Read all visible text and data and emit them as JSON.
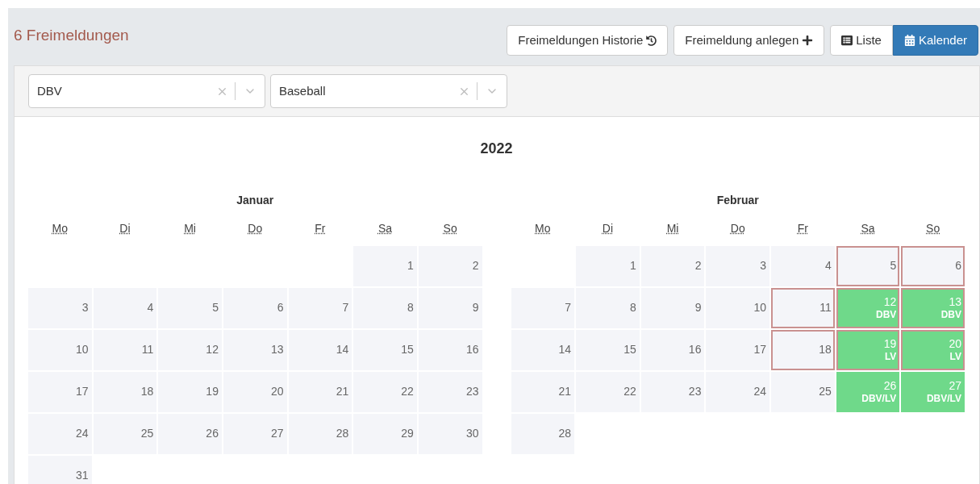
{
  "title": "6 Freimeldungen",
  "buttons": [
    {
      "label": "Freimeldungen Historie",
      "kind": "history"
    },
    {
      "label": "Freimeldung anlegen",
      "kind": "add"
    }
  ],
  "view_toggle": [
    {
      "label": "Liste",
      "kind": "list",
      "selected": false
    },
    {
      "label": "Kalender",
      "kind": "calendar",
      "selected": true
    }
  ],
  "filters": [
    {
      "value": "DBV"
    },
    {
      "value": "Baseball"
    }
  ],
  "year": "2022",
  "months": [
    {
      "name": "Januar",
      "weekdays": [
        "Mo",
        "Di",
        "Mi",
        "Do",
        "Fr",
        "Sa",
        "So"
      ],
      "weeks": [
        [
          {
            "kind": "empty"
          },
          {
            "kind": "empty"
          },
          {
            "kind": "empty"
          },
          {
            "kind": "empty"
          },
          {
            "kind": "empty"
          },
          {
            "kind": "day",
            "day": "1",
            "marked": false,
            "free": false
          },
          {
            "kind": "day",
            "day": "2",
            "marked": false,
            "free": false
          }
        ],
        [
          {
            "kind": "day",
            "day": "3",
            "marked": false,
            "free": false
          },
          {
            "kind": "day",
            "day": "4",
            "marked": false,
            "free": false
          },
          {
            "kind": "day",
            "day": "5",
            "marked": false,
            "free": false
          },
          {
            "kind": "day",
            "day": "6",
            "marked": false,
            "free": false
          },
          {
            "kind": "day",
            "day": "7",
            "marked": false,
            "free": false
          },
          {
            "kind": "day",
            "day": "8",
            "marked": false,
            "free": false
          },
          {
            "kind": "day",
            "day": "9",
            "marked": false,
            "free": false
          }
        ],
        [
          {
            "kind": "day",
            "day": "10",
            "marked": false,
            "free": false
          },
          {
            "kind": "day",
            "day": "11",
            "marked": false,
            "free": false
          },
          {
            "kind": "day",
            "day": "12",
            "marked": false,
            "free": false
          },
          {
            "kind": "day",
            "day": "13",
            "marked": false,
            "free": false
          },
          {
            "kind": "day",
            "day": "14",
            "marked": false,
            "free": false
          },
          {
            "kind": "day",
            "day": "15",
            "marked": false,
            "free": false
          },
          {
            "kind": "day",
            "day": "16",
            "marked": false,
            "free": false
          }
        ],
        [
          {
            "kind": "day",
            "day": "17",
            "marked": false,
            "free": false
          },
          {
            "kind": "day",
            "day": "18",
            "marked": false,
            "free": false
          },
          {
            "kind": "day",
            "day": "19",
            "marked": false,
            "free": false
          },
          {
            "kind": "day",
            "day": "20",
            "marked": false,
            "free": false
          },
          {
            "kind": "day",
            "day": "21",
            "marked": false,
            "free": false
          },
          {
            "kind": "day",
            "day": "22",
            "marked": false,
            "free": false
          },
          {
            "kind": "day",
            "day": "23",
            "marked": false,
            "free": false
          }
        ],
        [
          {
            "kind": "day",
            "day": "24",
            "marked": false,
            "free": false
          },
          {
            "kind": "day",
            "day": "25",
            "marked": false,
            "free": false
          },
          {
            "kind": "day",
            "day": "26",
            "marked": false,
            "free": false
          },
          {
            "kind": "day",
            "day": "27",
            "marked": false,
            "free": false
          },
          {
            "kind": "day",
            "day": "28",
            "marked": false,
            "free": false
          },
          {
            "kind": "day",
            "day": "29",
            "marked": false,
            "free": false
          },
          {
            "kind": "day",
            "day": "30",
            "marked": false,
            "free": false
          }
        ],
        [
          {
            "kind": "day",
            "day": "31",
            "marked": false,
            "free": false
          }
        ]
      ]
    },
    {
      "name": "Februar",
      "weekdays": [
        "Mo",
        "Di",
        "Mi",
        "Do",
        "Fr",
        "Sa",
        "So"
      ],
      "weeks": [
        [
          {
            "kind": "empty"
          },
          {
            "kind": "day",
            "day": "1",
            "marked": false,
            "free": false
          },
          {
            "kind": "day",
            "day": "2",
            "marked": false,
            "free": false
          },
          {
            "kind": "day",
            "day": "3",
            "marked": false,
            "free": false
          },
          {
            "kind": "day",
            "day": "4",
            "marked": false,
            "free": false
          },
          {
            "kind": "day",
            "day": "5",
            "marked": true,
            "free": false
          },
          {
            "kind": "day",
            "day": "6",
            "marked": true,
            "free": false
          }
        ],
        [
          {
            "kind": "day",
            "day": "7",
            "marked": false,
            "free": false
          },
          {
            "kind": "day",
            "day": "8",
            "marked": false,
            "free": false
          },
          {
            "kind": "day",
            "day": "9",
            "marked": false,
            "free": false
          },
          {
            "kind": "day",
            "day": "10",
            "marked": false,
            "free": false
          },
          {
            "kind": "day",
            "day": "11",
            "marked": true,
            "free": false
          },
          {
            "kind": "day",
            "day": "12",
            "marked": true,
            "free": true,
            "label": "DBV"
          },
          {
            "kind": "day",
            "day": "13",
            "marked": true,
            "free": true,
            "label": "DBV"
          }
        ],
        [
          {
            "kind": "day",
            "day": "14",
            "marked": false,
            "free": false
          },
          {
            "kind": "day",
            "day": "15",
            "marked": false,
            "free": false
          },
          {
            "kind": "day",
            "day": "16",
            "marked": false,
            "free": false
          },
          {
            "kind": "day",
            "day": "17",
            "marked": false,
            "free": false
          },
          {
            "kind": "day",
            "day": "18",
            "marked": true,
            "free": false
          },
          {
            "kind": "day",
            "day": "19",
            "marked": true,
            "free": true,
            "label": "LV"
          },
          {
            "kind": "day",
            "day": "20",
            "marked": true,
            "free": true,
            "label": "LV"
          }
        ],
        [
          {
            "kind": "day",
            "day": "21",
            "marked": false,
            "free": false
          },
          {
            "kind": "day",
            "day": "22",
            "marked": false,
            "free": false
          },
          {
            "kind": "day",
            "day": "23",
            "marked": false,
            "free": false
          },
          {
            "kind": "day",
            "day": "24",
            "marked": false,
            "free": false
          },
          {
            "kind": "day",
            "day": "25",
            "marked": false,
            "free": false
          },
          {
            "kind": "day",
            "day": "26",
            "marked": false,
            "free": true,
            "label": "DBV/LV"
          },
          {
            "kind": "day",
            "day": "27",
            "marked": false,
            "free": true,
            "label": "DBV/LV"
          }
        ],
        [
          {
            "kind": "day",
            "day": "28",
            "marked": false,
            "free": false
          }
        ]
      ]
    }
  ]
}
